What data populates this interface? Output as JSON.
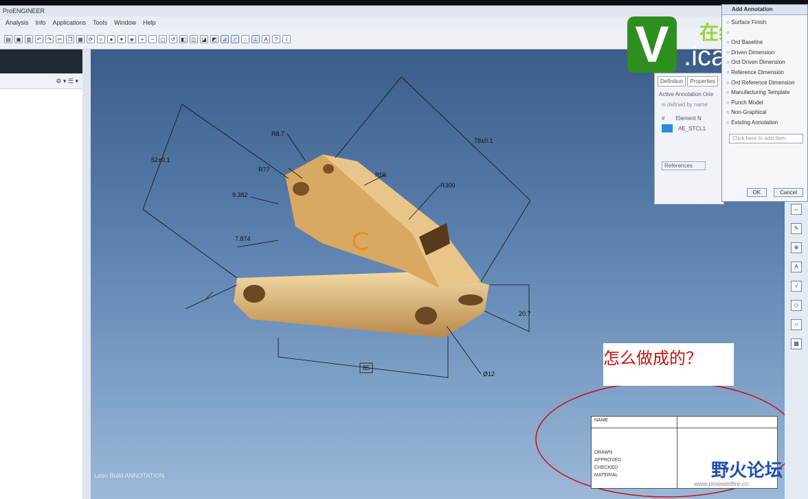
{
  "window": {
    "title": "ProENGINEER"
  },
  "menu": [
    "Analysis",
    "Info",
    "Applications",
    "Tools",
    "Window",
    "Help"
  ],
  "viewport": {
    "bottom_label": "Lean Build ANNOTATION",
    "dimensions": {
      "d1": "52±0.1",
      "d2": "R8.7",
      "d3": "R77",
      "d4": "9.382",
      "d5": "R55",
      "d6": "R300",
      "d7": "78±0.1",
      "d8": "7.874",
      "d9": "20.7",
      "d10": "85",
      "d11": "Ø12"
    }
  },
  "logo": {
    "letter": "V",
    "cn": "在线视频",
    "url": ".icax.cn"
  },
  "properties_dialog": {
    "tabs": [
      "Definition",
      "Properties"
    ],
    "field1": "Active Annotation Orie",
    "field2": "is defined by name",
    "col1": "#",
    "col2": "Element N",
    "row_value": "AE_STCL1",
    "button": "References"
  },
  "add_annotation": {
    "title": "Add Annotation",
    "options": [
      "Surface Finish",
      "",
      "Ord Baseline",
      "Driven Dimension",
      "Ord Driven Dimension",
      "Reference Dimension",
      "Ord Reference Dimension",
      "Manufacturing Template",
      "Punch Model",
      "Non-Graphical",
      "Existing Annotation"
    ],
    "placeholder": "Click here to add item",
    "ok": "OK",
    "cancel": "Cancel"
  },
  "note": {
    "text": "怎么做成的？"
  },
  "title_block": {
    "name_label": "NAME",
    "rows": [
      "DRAWN",
      "APPROVED",
      "CHECKED",
      "",
      "MATERIAL"
    ]
  },
  "watermark": {
    "cn": "野火论坛",
    "url": "www.proewildfire.cn"
  },
  "colors": {
    "viewport_top": "#3b5c88",
    "viewport_bottom": "#9cb8d8",
    "part": "#d9ad6c",
    "note_red": "#c91010"
  }
}
